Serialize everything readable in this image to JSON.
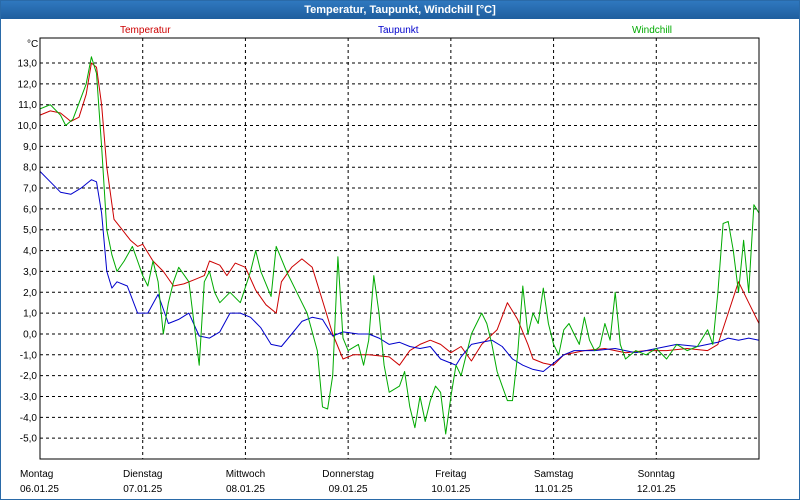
{
  "window": {
    "title": "Temperatur, Taupunkt, Windchill [°C]"
  },
  "colors": {
    "temperatur": "#cc0000",
    "taupunkt": "#0000cc",
    "windchill": "#00aa00",
    "grid": "#000000"
  },
  "chart_data": {
    "type": "line",
    "title": "Temperatur, Taupunkt, Windchill [°C]",
    "yunit": "°C",
    "ylim": [
      -6,
      14.2
    ],
    "yticks": [
      "13,0",
      "12,0",
      "11,0",
      "10,0",
      "9,0",
      "8,0",
      "7,0",
      "6,0",
      "5,0",
      "4,0",
      "3,0",
      "2,0",
      "1,0",
      "0,0",
      "-1,0",
      "-2,0",
      "-3,0",
      "-4,0",
      "-5,0"
    ],
    "ytick_values": [
      13,
      12,
      11,
      10,
      9,
      8,
      7,
      6,
      5,
      4,
      3,
      2,
      1,
      0,
      -1,
      -2,
      -3,
      -4,
      -5
    ],
    "xlim": [
      0,
      7
    ],
    "grid": true,
    "legend_position": "top",
    "days": [
      {
        "day": "Montag",
        "date": "06.01.25"
      },
      {
        "day": "Dienstag",
        "date": "07.01.25"
      },
      {
        "day": "Mittwoch",
        "date": "08.01.25"
      },
      {
        "day": "Donnerstag",
        "date": "09.01.25"
      },
      {
        "day": "Freitag",
        "date": "10.01.25"
      },
      {
        "day": "Samstag",
        "date": "11.01.25"
      },
      {
        "day": "Sonntag",
        "date": "12.01.25"
      }
    ],
    "series": [
      {
        "name": "Temperatur",
        "color": "#cc0000",
        "points": [
          [
            0,
            10.5
          ],
          [
            0.1,
            10.7
          ],
          [
            0.2,
            10.6
          ],
          [
            0.3,
            10.2
          ],
          [
            0.38,
            10.4
          ],
          [
            0.45,
            11.5
          ],
          [
            0.5,
            13.0
          ],
          [
            0.55,
            12.8
          ],
          [
            0.6,
            11.0
          ],
          [
            0.65,
            8.0
          ],
          [
            0.72,
            5.5
          ],
          [
            0.8,
            5.0
          ],
          [
            0.88,
            4.5
          ],
          [
            0.95,
            4.2
          ],
          [
            1.0,
            4.3
          ],
          [
            1.1,
            3.5
          ],
          [
            1.2,
            3.0
          ],
          [
            1.3,
            2.3
          ],
          [
            1.4,
            2.4
          ],
          [
            1.5,
            2.6
          ],
          [
            1.6,
            2.8
          ],
          [
            1.65,
            3.5
          ],
          [
            1.75,
            3.3
          ],
          [
            1.82,
            2.8
          ],
          [
            1.9,
            3.4
          ],
          [
            2.0,
            3.2
          ],
          [
            2.1,
            2.1
          ],
          [
            2.2,
            1.4
          ],
          [
            2.3,
            1.0
          ],
          [
            2.35,
            2.5
          ],
          [
            2.45,
            3.2
          ],
          [
            2.55,
            3.6
          ],
          [
            2.65,
            3.2
          ],
          [
            2.75,
            1.6
          ],
          [
            2.85,
            0.0
          ],
          [
            2.95,
            -1.2
          ],
          [
            3.05,
            -1.0
          ],
          [
            3.2,
            -1.0
          ],
          [
            3.4,
            -1.1
          ],
          [
            3.5,
            -1.5
          ],
          [
            3.6,
            -0.8
          ],
          [
            3.7,
            -0.5
          ],
          [
            3.8,
            -0.3
          ],
          [
            3.9,
            -0.5
          ],
          [
            4.0,
            -0.9
          ],
          [
            4.1,
            -0.6
          ],
          [
            4.2,
            -1.3
          ],
          [
            4.3,
            -0.5
          ],
          [
            4.45,
            0.2
          ],
          [
            4.55,
            1.5
          ],
          [
            4.65,
            0.7
          ],
          [
            4.75,
            -0.5
          ],
          [
            4.8,
            -1.2
          ],
          [
            4.9,
            -1.4
          ],
          [
            5.0,
            -1.5
          ],
          [
            5.1,
            -1.0
          ],
          [
            5.2,
            -0.9
          ],
          [
            5.3,
            -0.8
          ],
          [
            5.5,
            -0.7
          ],
          [
            5.7,
            -0.9
          ],
          [
            5.9,
            -0.8
          ],
          [
            6.1,
            -0.8
          ],
          [
            6.3,
            -0.7
          ],
          [
            6.5,
            -0.8
          ],
          [
            6.6,
            -0.5
          ],
          [
            6.7,
            1.0
          ],
          [
            6.8,
            2.5
          ],
          [
            6.9,
            1.5
          ],
          [
            7.0,
            0.5
          ]
        ]
      },
      {
        "name": "Taupunkt",
        "color": "#0000cc",
        "points": [
          [
            0,
            7.8
          ],
          [
            0.1,
            7.3
          ],
          [
            0.2,
            6.8
          ],
          [
            0.3,
            6.7
          ],
          [
            0.4,
            7.0
          ],
          [
            0.5,
            7.4
          ],
          [
            0.55,
            7.3
          ],
          [
            0.6,
            5.8
          ],
          [
            0.65,
            3.0
          ],
          [
            0.7,
            2.2
          ],
          [
            0.75,
            2.5
          ],
          [
            0.85,
            2.3
          ],
          [
            0.95,
            1.0
          ],
          [
            1.05,
            1.0
          ],
          [
            1.15,
            1.9
          ],
          [
            1.25,
            0.5
          ],
          [
            1.35,
            0.7
          ],
          [
            1.45,
            1.0
          ],
          [
            1.55,
            -0.1
          ],
          [
            1.65,
            -0.2
          ],
          [
            1.75,
            0.1
          ],
          [
            1.85,
            1.0
          ],
          [
            1.95,
            1.0
          ],
          [
            2.05,
            0.8
          ],
          [
            2.15,
            0.3
          ],
          [
            2.25,
            -0.5
          ],
          [
            2.35,
            -0.6
          ],
          [
            2.45,
            0.0
          ],
          [
            2.55,
            0.6
          ],
          [
            2.65,
            0.8
          ],
          [
            2.75,
            0.7
          ],
          [
            2.85,
            -0.1
          ],
          [
            2.95,
            0.1
          ],
          [
            3.1,
            0.0
          ],
          [
            3.2,
            0.0
          ],
          [
            3.3,
            -0.2
          ],
          [
            3.4,
            -0.5
          ],
          [
            3.5,
            -0.4
          ],
          [
            3.6,
            -0.6
          ],
          [
            3.7,
            -0.7
          ],
          [
            3.8,
            -0.6
          ],
          [
            3.9,
            -1.2
          ],
          [
            4.0,
            -1.4
          ],
          [
            4.05,
            -1.5
          ],
          [
            4.1,
            -1.1
          ],
          [
            4.2,
            -0.5
          ],
          [
            4.3,
            -0.4
          ],
          [
            4.4,
            -0.3
          ],
          [
            4.5,
            -0.6
          ],
          [
            4.6,
            -1.2
          ],
          [
            4.7,
            -1.5
          ],
          [
            4.8,
            -1.7
          ],
          [
            4.9,
            -1.8
          ],
          [
            5.0,
            -1.4
          ],
          [
            5.1,
            -1.0
          ],
          [
            5.2,
            -0.8
          ],
          [
            5.4,
            -0.8
          ],
          [
            5.6,
            -0.7
          ],
          [
            5.8,
            -0.9
          ],
          [
            6.0,
            -0.7
          ],
          [
            6.2,
            -0.5
          ],
          [
            6.4,
            -0.6
          ],
          [
            6.6,
            -0.4
          ],
          [
            6.7,
            -0.2
          ],
          [
            6.8,
            -0.3
          ],
          [
            6.9,
            -0.2
          ],
          [
            7.0,
            -0.3
          ]
        ]
      },
      {
        "name": "Windchill",
        "color": "#00aa00",
        "points": [
          [
            0,
            10.8
          ],
          [
            0.1,
            11.0
          ],
          [
            0.2,
            10.5
          ],
          [
            0.25,
            10.0
          ],
          [
            0.32,
            10.3
          ],
          [
            0.45,
            12.0
          ],
          [
            0.5,
            13.3
          ],
          [
            0.55,
            12.5
          ],
          [
            0.6,
            9.0
          ],
          [
            0.65,
            5.0
          ],
          [
            0.7,
            3.8
          ],
          [
            0.75,
            3.0
          ],
          [
            0.82,
            3.5
          ],
          [
            0.9,
            4.2
          ],
          [
            0.95,
            3.5
          ],
          [
            1.0,
            2.8
          ],
          [
            1.05,
            2.3
          ],
          [
            1.1,
            3.5
          ],
          [
            1.15,
            2.5
          ],
          [
            1.2,
            0.0
          ],
          [
            1.25,
            1.5
          ],
          [
            1.3,
            2.5
          ],
          [
            1.35,
            3.2
          ],
          [
            1.45,
            2.5
          ],
          [
            1.55,
            -1.5
          ],
          [
            1.6,
            2.5
          ],
          [
            1.65,
            3.0
          ],
          [
            1.7,
            2.0
          ],
          [
            1.75,
            1.5
          ],
          [
            1.85,
            2.0
          ],
          [
            1.95,
            1.5
          ],
          [
            2.05,
            3.0
          ],
          [
            2.1,
            4.0
          ],
          [
            2.15,
            3.0
          ],
          [
            2.25,
            1.8
          ],
          [
            2.3,
            4.2
          ],
          [
            2.35,
            3.6
          ],
          [
            2.4,
            3.0
          ],
          [
            2.5,
            2.0
          ],
          [
            2.55,
            1.5
          ],
          [
            2.6,
            1.0
          ],
          [
            2.7,
            -0.8
          ],
          [
            2.75,
            -3.5
          ],
          [
            2.8,
            -3.6
          ],
          [
            2.85,
            -2.0
          ],
          [
            2.9,
            3.7
          ],
          [
            2.95,
            -0.2
          ],
          [
            3.0,
            -0.8
          ],
          [
            3.1,
            -0.5
          ],
          [
            3.15,
            -1.5
          ],
          [
            3.2,
            -0.3
          ],
          [
            3.25,
            2.8
          ],
          [
            3.3,
            1.0
          ],
          [
            3.35,
            -1.5
          ],
          [
            3.4,
            -2.8
          ],
          [
            3.5,
            -2.5
          ],
          [
            3.55,
            -1.8
          ],
          [
            3.6,
            -3.5
          ],
          [
            3.65,
            -4.5
          ],
          [
            3.7,
            -3.0
          ],
          [
            3.75,
            -4.2
          ],
          [
            3.8,
            -3.2
          ],
          [
            3.85,
            -2.5
          ],
          [
            3.9,
            -2.8
          ],
          [
            3.95,
            -4.8
          ],
          [
            4.0,
            -3.0
          ],
          [
            4.05,
            -1.5
          ],
          [
            4.1,
            -2.0
          ],
          [
            4.2,
            0.0
          ],
          [
            4.3,
            1.0
          ],
          [
            4.35,
            0.5
          ],
          [
            4.4,
            -0.5
          ],
          [
            4.45,
            -1.8
          ],
          [
            4.5,
            -2.5
          ],
          [
            4.55,
            -3.2
          ],
          [
            4.6,
            -3.2
          ],
          [
            4.65,
            -1.0
          ],
          [
            4.7,
            2.3
          ],
          [
            4.75,
            0.0
          ],
          [
            4.8,
            1.0
          ],
          [
            4.85,
            0.5
          ],
          [
            4.9,
            2.2
          ],
          [
            4.95,
            0.5
          ],
          [
            5.0,
            -0.5
          ],
          [
            5.05,
            -1.0
          ],
          [
            5.1,
            0.2
          ],
          [
            5.15,
            0.5
          ],
          [
            5.2,
            0.0
          ],
          [
            5.25,
            -0.5
          ],
          [
            5.3,
            0.8
          ],
          [
            5.35,
            -0.3
          ],
          [
            5.4,
            -0.8
          ],
          [
            5.45,
            -0.6
          ],
          [
            5.5,
            0.5
          ],
          [
            5.55,
            -0.3
          ],
          [
            5.6,
            2.0
          ],
          [
            5.65,
            -0.5
          ],
          [
            5.7,
            -1.2
          ],
          [
            5.8,
            -0.8
          ],
          [
            5.9,
            -1.0
          ],
          [
            6.0,
            -0.7
          ],
          [
            6.1,
            -1.2
          ],
          [
            6.2,
            -0.5
          ],
          [
            6.3,
            -0.8
          ],
          [
            6.4,
            -0.6
          ],
          [
            6.5,
            0.2
          ],
          [
            6.55,
            -0.5
          ],
          [
            6.6,
            2.0
          ],
          [
            6.65,
            5.3
          ],
          [
            6.7,
            5.4
          ],
          [
            6.75,
            4.0
          ],
          [
            6.8,
            2.0
          ],
          [
            6.85,
            4.5
          ],
          [
            6.9,
            2.0
          ],
          [
            6.95,
            6.2
          ],
          [
            7.0,
            5.8
          ]
        ]
      }
    ]
  }
}
